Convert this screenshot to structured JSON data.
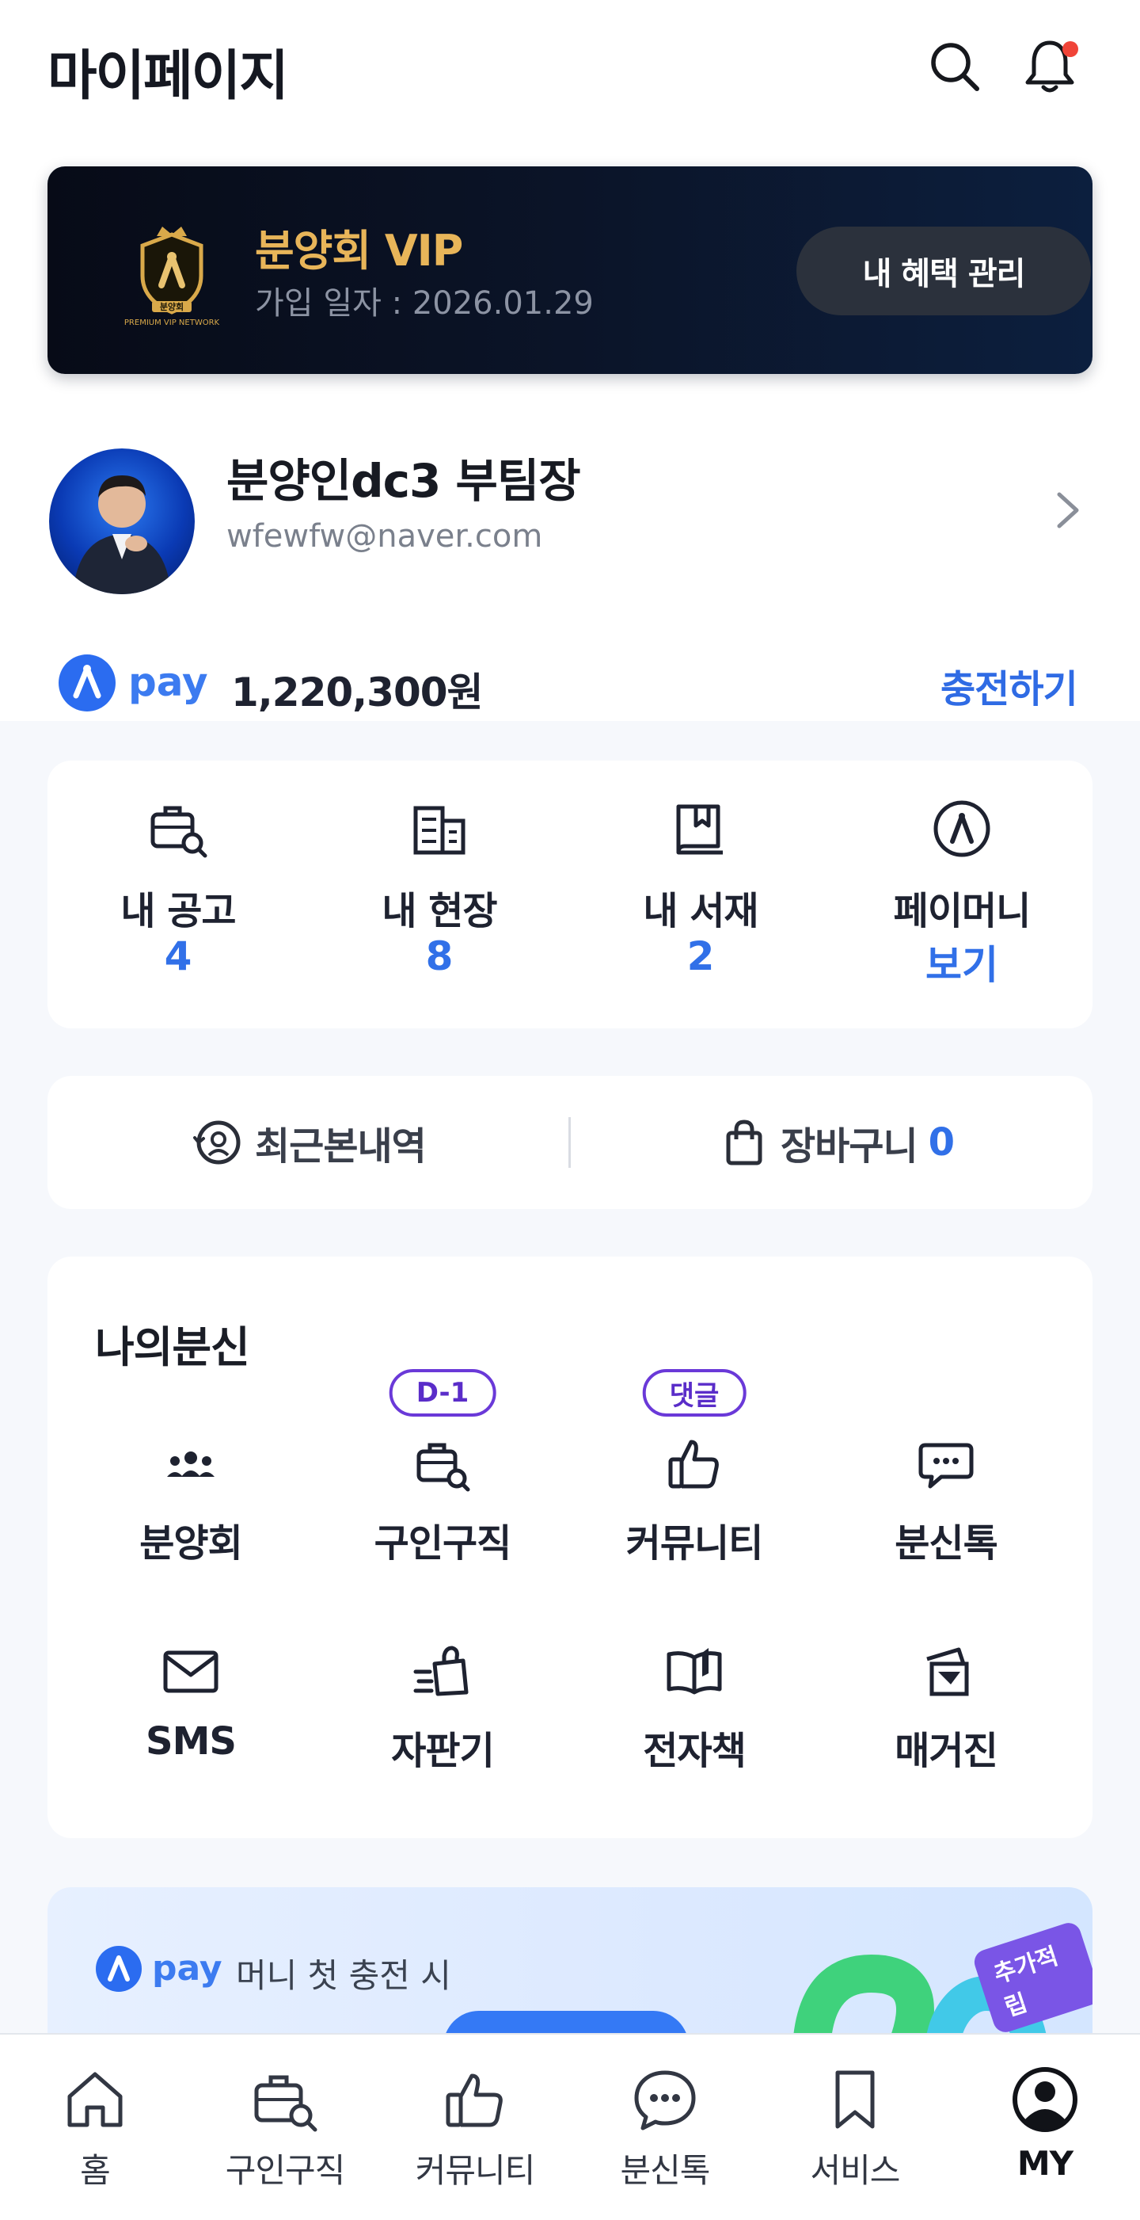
{
  "header": {
    "title": "마이페이지",
    "search_icon": "search-icon",
    "bell_icon": "bell-icon",
    "has_notification": true
  },
  "vip": {
    "emblem_text": "분양회",
    "emblem_subtext": "PREMIUM VIP NETWORK",
    "title": "분양회 VIP",
    "join_date": "가입 일자 : 2026.01.29",
    "button_label": "내 혜택 관리"
  },
  "profile": {
    "name": "분양인dc3 부팀장",
    "email": "wfewfw@naver.com"
  },
  "pay": {
    "logo_text": "pay",
    "balance": "1,220,300원",
    "charge_label": "충전하기"
  },
  "stats": [
    {
      "label": "내 공고",
      "value": "4",
      "icon": "briefcase-search-icon"
    },
    {
      "label": "내 현장",
      "value": "8",
      "icon": "building-icon"
    },
    {
      "label": "내 서재",
      "value": "2",
      "icon": "book-icon"
    },
    {
      "label": "페이머니",
      "value": "보기",
      "icon": "pay-money-icon"
    }
  ],
  "quick": {
    "recent_label": "최근본내역",
    "cart_label": "장바구니",
    "cart_count": "0"
  },
  "my_menu": {
    "title": "나의분신",
    "items": [
      {
        "label": "분양회",
        "icon": "group-icon",
        "badge": ""
      },
      {
        "label": "구인구직",
        "icon": "briefcase-search-icon",
        "badge": "D-1"
      },
      {
        "label": "커뮤니티",
        "icon": "thumbs-up-icon",
        "badge": "댓글"
      },
      {
        "label": "분신톡",
        "icon": "chat-icon",
        "badge": ""
      },
      {
        "label": "SMS",
        "icon": "mail-icon",
        "badge": ""
      },
      {
        "label": "자판기",
        "icon": "shopping-bag-fast-icon",
        "badge": ""
      },
      {
        "label": "전자책",
        "icon": "open-book-icon",
        "badge": ""
      },
      {
        "label": "매거진",
        "icon": "magazine-icon",
        "badge": ""
      }
    ]
  },
  "promo": {
    "logo_text": "pay",
    "text": "머니 첫 충전 시",
    "tag": "추가적립"
  },
  "bottom_nav": [
    {
      "label": "홈",
      "icon": "home-icon",
      "active": false
    },
    {
      "label": "구인구직",
      "icon": "briefcase-search-icon",
      "active": false
    },
    {
      "label": "커뮤니티",
      "icon": "thumbs-up-icon",
      "active": false
    },
    {
      "label": "분신톡",
      "icon": "chat-icon",
      "active": false
    },
    {
      "label": "서비스",
      "icon": "bookmark-icon",
      "active": false
    },
    {
      "label": "MY",
      "icon": "user-circle-icon",
      "active": true
    }
  ],
  "colors": {
    "accent": "#3170E8",
    "vip_gold": "#E8B559",
    "badge_purple": "#6A39D8",
    "notification": "#F04438"
  }
}
